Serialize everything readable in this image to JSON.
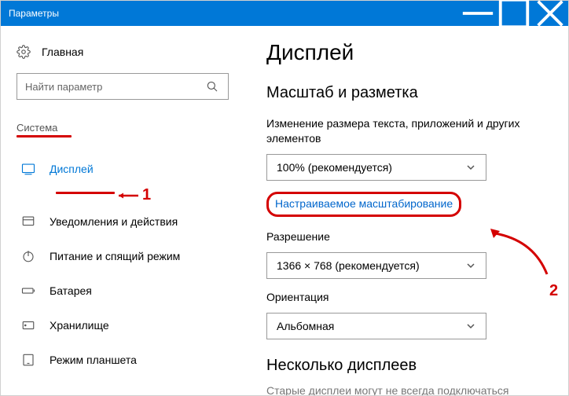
{
  "window": {
    "title": "Параметры"
  },
  "sidebar": {
    "home": "Главная",
    "search_placeholder": "Найти параметр",
    "category": "Система",
    "items": [
      {
        "label": "Дисплей"
      },
      {
        "label": "Уведомления и действия"
      },
      {
        "label": "Питание и спящий режим"
      },
      {
        "label": "Батарея"
      },
      {
        "label": "Хранилище"
      },
      {
        "label": "Режим планшета"
      }
    ]
  },
  "content": {
    "title": "Дисплей",
    "section_scale": "Масштаб и разметка",
    "scale_label": "Изменение размера текста, приложений и других элементов",
    "scale_value": "100% (рекомендуется)",
    "custom_scale_link": "Настраиваемое масштабирование",
    "resolution_label": "Разрешение",
    "resolution_value": "1366 × 768 (рекомендуется)",
    "orientation_label": "Ориентация",
    "orientation_value": "Альбомная",
    "section_multi": "Несколько дисплеев",
    "cutoff_text": "Старые дисплеи могут не всегда подключаться"
  },
  "annotations": {
    "num1": "1",
    "num2": "2"
  }
}
